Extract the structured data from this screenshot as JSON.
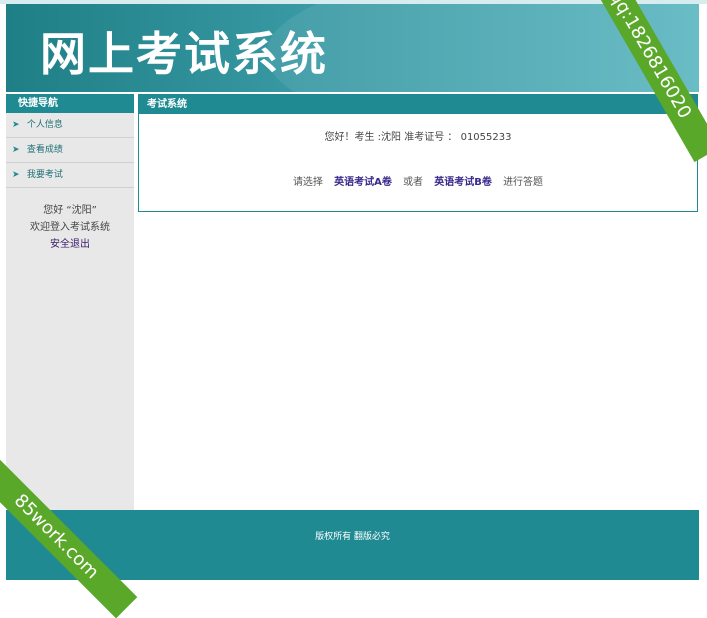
{
  "header": {
    "title": "网上考试系统"
  },
  "sidebar": {
    "heading": "快捷导航",
    "items": [
      {
        "label": "个人信息"
      },
      {
        "label": "查看成绩"
      },
      {
        "label": "我要考试"
      }
    ],
    "welcome": {
      "hello": "您好 “沈阳”",
      "message": "欢迎登入考试系统",
      "logout": "安全退出"
    }
  },
  "main": {
    "heading": "考试系统",
    "greeting": "您好！考生 :沈阳 准考证号 ： 01055233",
    "choose_prefix": "请选择",
    "exam_a": "英语考试A卷",
    "or": "或者",
    "exam_b": "英语考试B卷",
    "choose_suffix": "进行答题"
  },
  "footer": {
    "copyright": "版权所有 翻版必究"
  },
  "watermarks": {
    "top_right": "qq:1826816020",
    "bottom_left": "85work.com"
  },
  "colors": {
    "teal": "#1f8a92",
    "ribbon": "#5aa82a"
  }
}
